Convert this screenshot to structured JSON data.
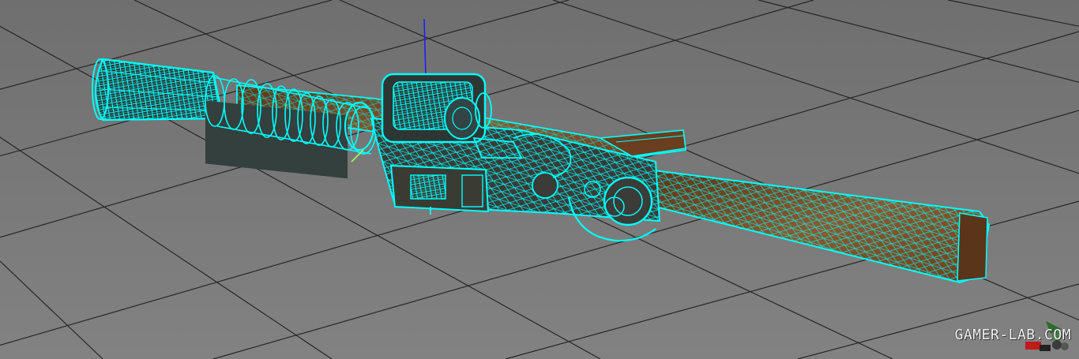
{
  "viewport": {
    "colors": {
      "background": "#787878",
      "grid_line": "#1e1e1e",
      "wireframe": "#00ffff",
      "wood": "#7a4a26",
      "metal": "#3a3a36",
      "axis": "#1a1aff"
    }
  },
  "watermark": {
    "text": "GAMER-LAB.COM",
    "logo_icon": "gamer-lab-logo-icon"
  }
}
